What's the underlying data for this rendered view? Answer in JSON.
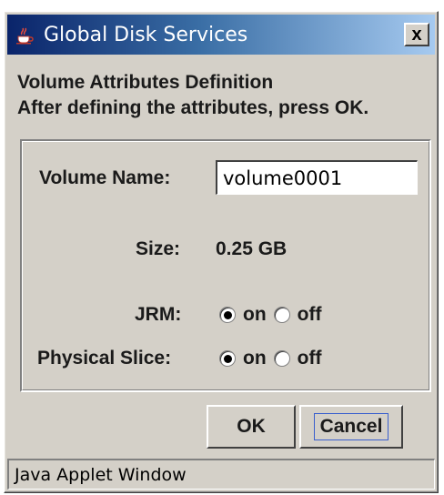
{
  "window": {
    "title": "Global Disk Services",
    "close_label": "x"
  },
  "heading": {
    "line1": "Volume Attributes Definition",
    "line2": "After defining the attributes, press OK."
  },
  "form": {
    "volume_name_label": "Volume Name:",
    "volume_name_value": "volume0001",
    "size_label": "Size:",
    "size_value": "0.25 GB",
    "jrm_label": "JRM:",
    "jrm_options": [
      "on",
      "off"
    ],
    "jrm_selected": "on",
    "physical_slice_label": "Physical Slice:",
    "physical_slice_options": [
      "on",
      "off"
    ],
    "physical_slice_selected": "on"
  },
  "buttons": {
    "ok_label": "OK",
    "cancel_label": "Cancel"
  },
  "status": {
    "text": "Java Applet Window"
  }
}
